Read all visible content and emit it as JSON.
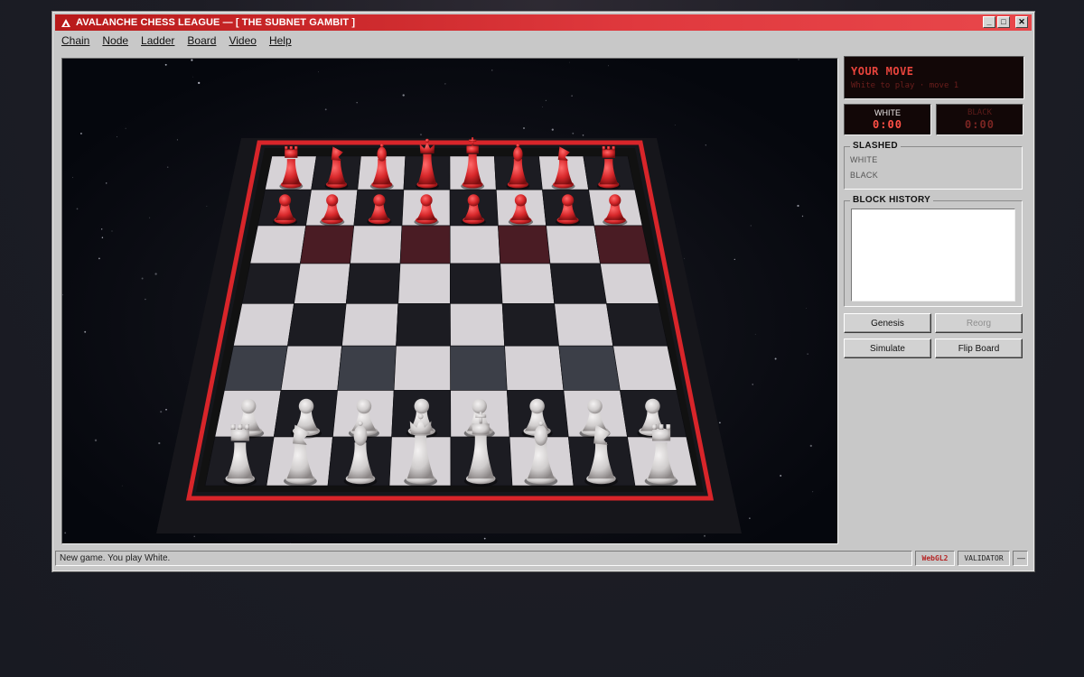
{
  "window": {
    "title": "AVALANCHE CHESS LEAGUE  —  [ THE SUBNET GAMBIT ]",
    "controls": [
      "_",
      "□",
      "✕"
    ]
  },
  "menu": [
    {
      "label": "Chain"
    },
    {
      "label": "Node"
    },
    {
      "label": "Ladder"
    },
    {
      "label": "Board"
    },
    {
      "label": "Video"
    },
    {
      "label": "Help"
    }
  ],
  "status": {
    "title": "YOUR MOVE",
    "subtitle": "White to play · move 1"
  },
  "clocks": {
    "white": {
      "label": "WHITE",
      "time": "0:00"
    },
    "black": {
      "label": "BLACK",
      "time": "0:00"
    }
  },
  "slashed": {
    "legend": "SLASHED",
    "white_label": "WHITE",
    "black_label": "BLACK"
  },
  "history": {
    "legend": "BLOCK HISTORY"
  },
  "buttons": {
    "genesis": "Genesis",
    "reorg": "Reorg",
    "simulate": "Simulate",
    "flip": "Flip Board"
  },
  "statusbar": {
    "message": "New game. You play White.",
    "renderer": "WebGL2",
    "role": "VALIDATOR",
    "extra": "—"
  },
  "board": {
    "black_back_rank": [
      "rook",
      "knight",
      "bishop",
      "queen",
      "king",
      "bishop",
      "knight",
      "rook"
    ],
    "white_back_rank": [
      "rook",
      "knight",
      "bishop",
      "queen",
      "king",
      "bishop",
      "knight",
      "rook"
    ],
    "red_pieces_color": "#d8282b",
    "white_pieces_color": "#d9d6d6",
    "frame_color": "#d8252a"
  },
  "colors": {
    "accent": "#e0393e",
    "panel": "#c8c8c8"
  }
}
